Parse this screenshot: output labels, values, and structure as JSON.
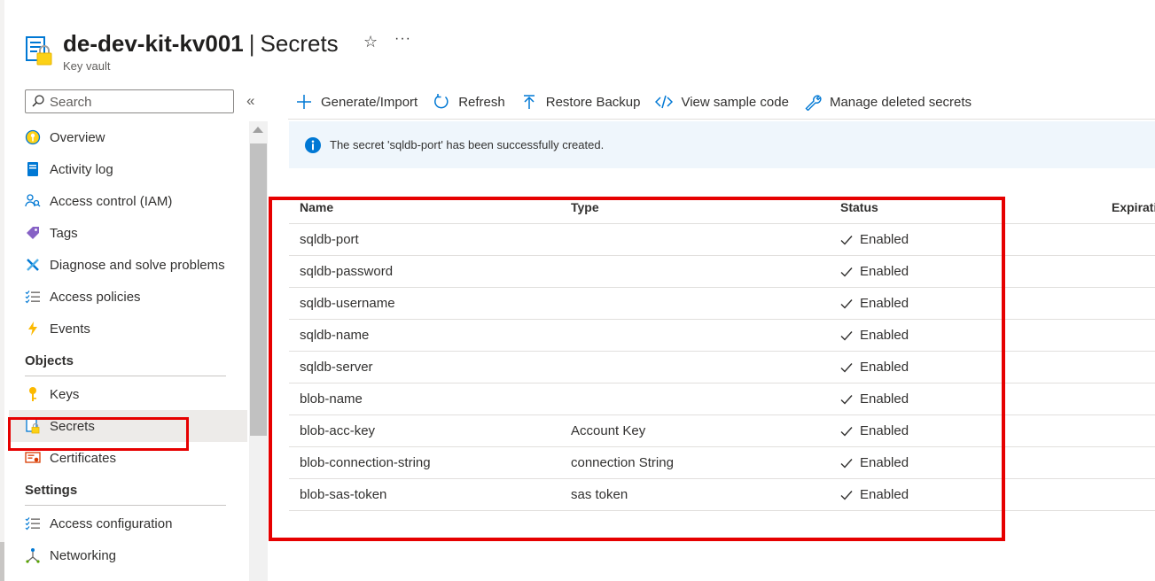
{
  "header": {
    "resource_name": "de-dev-kit-kv001",
    "separator": "|",
    "blade_title": "Secrets",
    "subtitle": "Key vault",
    "star_glyph": "☆",
    "more_glyph": "···"
  },
  "sidebar": {
    "search_placeholder": "Search",
    "collapse_glyph": "«",
    "items": [
      {
        "label": "Overview",
        "icon": "overview-icon"
      },
      {
        "label": "Activity log",
        "icon": "activity-log-icon"
      },
      {
        "label": "Access control (IAM)",
        "icon": "iam-icon"
      },
      {
        "label": "Tags",
        "icon": "tag-icon"
      },
      {
        "label": "Diagnose and solve problems",
        "icon": "wrench-icon"
      },
      {
        "label": "Access policies",
        "icon": "list-check-icon"
      },
      {
        "label": "Events",
        "icon": "lightning-icon"
      }
    ],
    "sections": [
      {
        "title": "Objects",
        "items": [
          {
            "label": "Keys",
            "icon": "key-icon"
          },
          {
            "label": "Secrets",
            "icon": "secret-icon",
            "selected": true
          },
          {
            "label": "Certificates",
            "icon": "certificate-icon"
          }
        ]
      },
      {
        "title": "Settings",
        "items": [
          {
            "label": "Access configuration",
            "icon": "list-check-icon"
          },
          {
            "label": "Networking",
            "icon": "networking-icon"
          }
        ]
      }
    ]
  },
  "toolbar": {
    "generate_import": "Generate/Import",
    "refresh": "Refresh",
    "restore_backup": "Restore Backup",
    "view_sample_code": "View sample code",
    "manage_deleted": "Manage deleted secrets"
  },
  "banner": {
    "message": "The secret 'sqldb-port' has been successfully created."
  },
  "table": {
    "headers": {
      "name": "Name",
      "type": "Type",
      "status": "Status",
      "expiration": "Expirati"
    },
    "rows": [
      {
        "name": "sqldb-port",
        "type": "",
        "status": "Enabled"
      },
      {
        "name": "sqldb-password",
        "type": "",
        "status": "Enabled"
      },
      {
        "name": "sqldb-username",
        "type": "",
        "status": "Enabled"
      },
      {
        "name": "sqldb-name",
        "type": "",
        "status": "Enabled"
      },
      {
        "name": "sqldb-server",
        "type": "",
        "status": "Enabled"
      },
      {
        "name": "blob-name",
        "type": "",
        "status": "Enabled"
      },
      {
        "name": "blob-acc-key",
        "type": "Account Key",
        "status": "Enabled"
      },
      {
        "name": "blob-connection-string",
        "type": "connection String",
        "status": "Enabled"
      },
      {
        "name": "blob-sas-token",
        "type": "sas token",
        "status": "Enabled"
      }
    ]
  },
  "colors": {
    "accent": "#0078d4",
    "highlight_box": "#e60000",
    "banner_bg": "#eff6fc",
    "selected_bg": "#edebe9"
  }
}
